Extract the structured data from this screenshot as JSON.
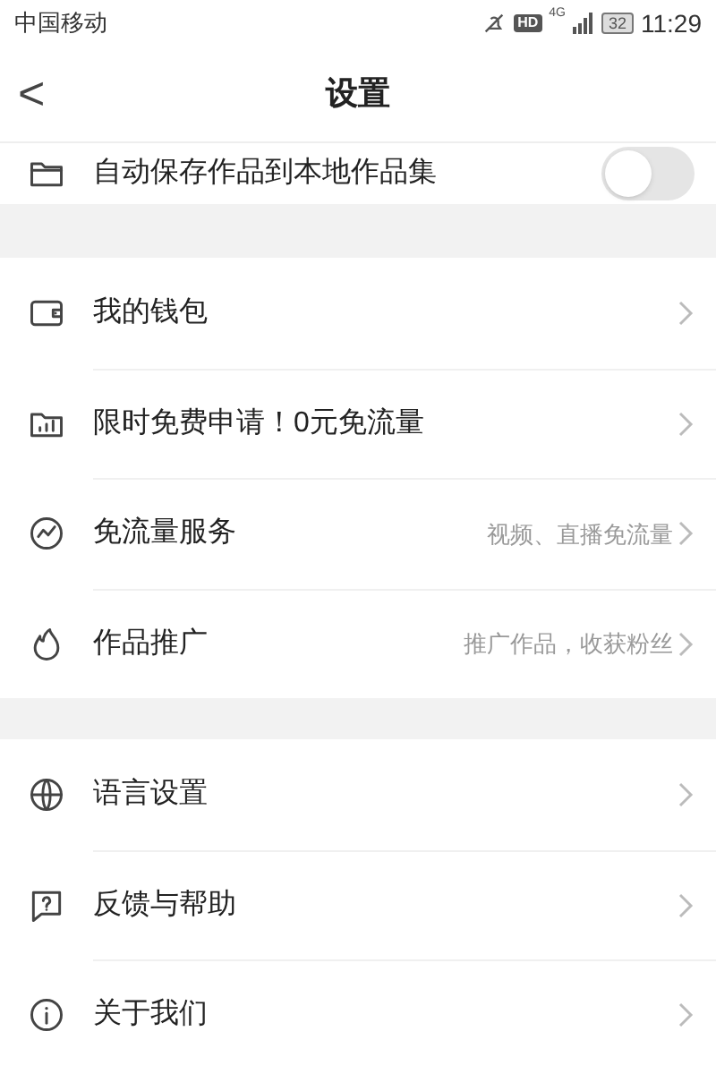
{
  "status_bar": {
    "carrier": "中国移动",
    "hd": "HD",
    "network": "4G",
    "battery": "32",
    "time": "11:29"
  },
  "header": {
    "back": "<",
    "title": "设置"
  },
  "sections": [
    {
      "items": [
        {
          "kind": "toggle",
          "label": "自动保存作品到本地作品集",
          "on": false
        }
      ]
    },
    {
      "items": [
        {
          "kind": "link",
          "label": "我的钱包"
        },
        {
          "kind": "link",
          "label": "限时免费申请！0元免流量"
        },
        {
          "kind": "link",
          "label": "免流量服务",
          "hint": "视频、直播免流量"
        },
        {
          "kind": "link",
          "label": "作品推广",
          "hint": "推广作品，收获粉丝"
        }
      ]
    },
    {
      "items": [
        {
          "kind": "link",
          "label": "语言设置"
        },
        {
          "kind": "link",
          "label": "反馈与帮助"
        },
        {
          "kind": "link",
          "label": "关于我们"
        }
      ]
    }
  ]
}
